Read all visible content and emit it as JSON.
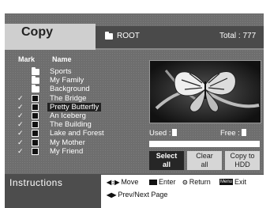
{
  "header": {
    "title": "Copy",
    "folder": "ROOT",
    "total": "Total : 777"
  },
  "columns": {
    "mark": "Mark",
    "name": "Name"
  },
  "folders": [
    "Sports",
    "My Family",
    "Background"
  ],
  "files": [
    {
      "name": "The Bridge",
      "checked": true,
      "selected": false
    },
    {
      "name": "Pretty Butterfly",
      "checked": true,
      "selected": true
    },
    {
      "name": "An Iceberg",
      "checked": true,
      "selected": false
    },
    {
      "name": "The Building",
      "checked": true,
      "selected": false
    },
    {
      "name": "Lake and Forest",
      "checked": true,
      "selected": false
    },
    {
      "name": "My Mother",
      "checked": true,
      "selected": false
    },
    {
      "name": "My Friend",
      "checked": true,
      "selected": false
    }
  ],
  "check_glyph": "✓",
  "status": {
    "used_label": "Used :",
    "free_label": "Free :"
  },
  "buttons": {
    "select_all": [
      "Select",
      "all"
    ],
    "clear_all": [
      "Clear",
      "all"
    ],
    "copy_hdd": [
      "Copy to",
      "HDD"
    ]
  },
  "instructions": {
    "title": "Instructions",
    "move": "Move",
    "enter": "Enter",
    "return": "Return",
    "exit": "Exit",
    "prev_next": "Prev/Next Page",
    "menu_key": "Menu"
  },
  "icons": {
    "move": "updown-arrow-icon",
    "enter": "enter-icon",
    "return": "return-icon",
    "menu": "menu-key-icon",
    "prevnext": "leftright-arrow-icon"
  }
}
